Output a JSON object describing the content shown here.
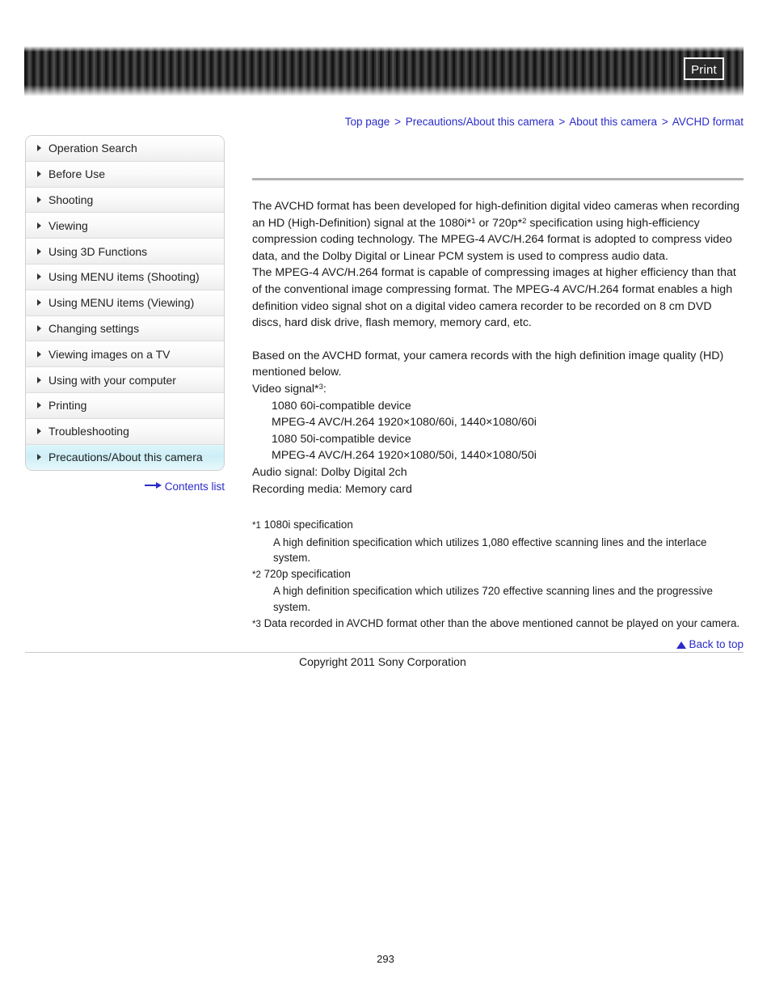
{
  "banner": {
    "print_label": "Print"
  },
  "breadcrumb": {
    "separator": ">",
    "items": [
      {
        "label": "Top page"
      },
      {
        "label": "Precautions/About this camera"
      },
      {
        "label": "About this camera"
      },
      {
        "label": "AVCHD format"
      }
    ]
  },
  "sidebar": {
    "items": [
      {
        "label": "Operation Search",
        "active": false
      },
      {
        "label": "Before Use",
        "active": false
      },
      {
        "label": "Shooting",
        "active": false
      },
      {
        "label": "Viewing",
        "active": false
      },
      {
        "label": "Using 3D Functions",
        "active": false
      },
      {
        "label": "Using MENU items (Shooting)",
        "active": false
      },
      {
        "label": "Using MENU items (Viewing)",
        "active": false
      },
      {
        "label": "Changing settings",
        "active": false
      },
      {
        "label": "Viewing images on a TV",
        "active": false
      },
      {
        "label": "Using with your computer",
        "active": false
      },
      {
        "label": "Printing",
        "active": false
      },
      {
        "label": "Troubleshooting",
        "active": false
      },
      {
        "label": "Precautions/About this camera",
        "active": true
      }
    ],
    "contents_list_label": "Contents list"
  },
  "main": {
    "paragraph1_part1": "The AVCHD format has been developed for high-definition digital video cameras when recording an HD (High-Definition) signal at the 1080i*",
    "paragraph1_sup1": "1",
    "paragraph1_part2": " or 720p*",
    "paragraph1_sup2": "2",
    "paragraph1_part3": " specification using high-efficiency compression coding technology. The MPEG-4 AVC/H.264 format is adopted to compress video data, and the Dolby Digital or Linear PCM system is used to compress audio data.",
    "paragraph2": "The MPEG-4 AVC/H.264 format is capable of compressing images at higher efficiency than that of the conventional image compressing format. The MPEG-4 AVC/H.264 format enables a high definition video signal shot on a digital video camera recorder to be recorded on 8 cm DVD discs, hard disk drive, flash memory, memory card, etc.",
    "paragraph3": "Based on the AVCHD format, your camera records with the high definition image quality (HD) mentioned below.",
    "video_signal_label": "Video signal*",
    "video_signal_sup": "3",
    "video_signal_colon": ":",
    "spec_lines": [
      "1080 60i-compatible device",
      "MPEG-4 AVC/H.264 1920×1080/60i, 1440×1080/60i",
      "1080 50i-compatible device",
      "MPEG-4 AVC/H.264 1920×1080/50i, 1440×1080/50i"
    ],
    "audio_signal": "Audio signal: Dolby Digital 2ch",
    "recording_media": "Recording media: Memory card",
    "footnotes": [
      {
        "marker": "*1",
        "title": "1080i specification",
        "body": "A high definition specification which utilizes 1,080 effective scanning lines and the interlace system."
      },
      {
        "marker": "*2",
        "title": "720p specification",
        "body": "A high definition specification which utilizes 720 effective scanning lines and the progressive system."
      },
      {
        "marker": "*3",
        "title": "Data recorded in AVCHD format other than the above mentioned cannot be played on your camera.",
        "body": ""
      }
    ]
  },
  "footer": {
    "back_to_top_label": "Back to top",
    "copyright": "Copyright 2011 Sony Corporation",
    "page_number": "293"
  }
}
